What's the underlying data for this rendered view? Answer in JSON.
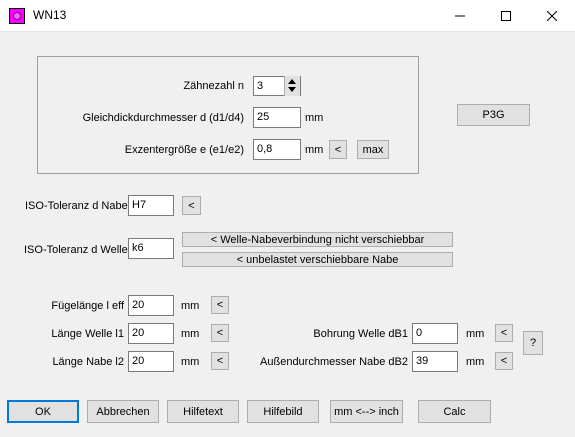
{
  "window": {
    "title": "WN13"
  },
  "titlebar": {
    "minimize_icon": "minimize-icon",
    "maximize_icon": "maximize-icon",
    "close_icon": "close-icon"
  },
  "group": {
    "zaehnezahl_label": "Zähnezahl n",
    "zaehnezahl_value": "3",
    "gleichdick_label": "Gleichdickdurchmesser d (d1/d4)",
    "gleichdick_value": "25",
    "gleichdick_unit": "mm",
    "exzenter_label": "Exzentergröße e (e1/e2)",
    "exzenter_value": "0,8",
    "exzenter_unit": "mm",
    "exzenter_less_btn": "<",
    "exzenter_max_btn": "max"
  },
  "p3g_btn": "P3G",
  "iso_nabe": {
    "label": "ISO-Toleranz d Nabe",
    "value": "H7",
    "btn": "<"
  },
  "iso_welle": {
    "label": "ISO-Toleranz d Welle",
    "value": "k6",
    "btn1": "< Welle-Nabeverbindung nicht verschiebbar",
    "btn2": "< unbelastet verschiebbare Nabe"
  },
  "fuegelaenge": {
    "label": "Fügelänge l eff",
    "value": "20",
    "unit": "mm",
    "btn": "<"
  },
  "laenge_welle": {
    "label": "Länge Welle l1",
    "value": "20",
    "unit": "mm",
    "btn": "<"
  },
  "laenge_nabe": {
    "label": "Länge Nabe l2",
    "value": "20",
    "unit": "mm",
    "btn": "<"
  },
  "bohrung": {
    "label": "Bohrung Welle dB1",
    "value": "0",
    "unit": "mm",
    "btn": "<"
  },
  "aussen": {
    "label": "Außendurchmesser Nabe dB2",
    "value": "39",
    "unit": "mm",
    "btn": "<"
  },
  "help_btn": "?",
  "footer": {
    "ok": "OK",
    "abbrechen": "Abbrechen",
    "hilfetext": "Hilfetext",
    "hilfebild": "Hilfebild",
    "mm_inch": "mm <--> inch",
    "calc": "Calc"
  }
}
